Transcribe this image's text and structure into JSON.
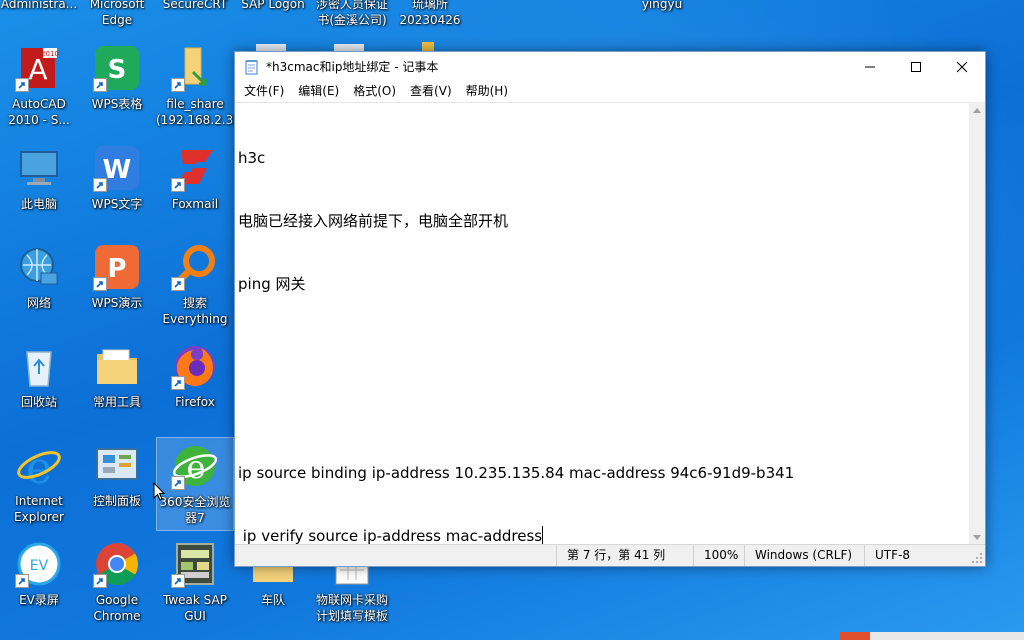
{
  "desktop": {
    "top_labels": [
      "Administra...",
      "Microsoft\nEdge",
      "SecureCRT",
      "SAP Logon",
      "涉密人员保证\n书(金溪公司)",
      "琉璃所\n20230426",
      "yingyu"
    ],
    "icons": [
      {
        "label": "AutoCAD\n2010 - S...",
        "icon": "autocad-icon"
      },
      {
        "label": "WPS表格",
        "icon": "wps-sheets-icon"
      },
      {
        "label": "file_share\n(192.168.2.3)",
        "icon": "folder-share-icon"
      },
      {
        "label": "此电脑",
        "icon": "this-pc-icon"
      },
      {
        "label": "WPS文字",
        "icon": "wps-writer-icon"
      },
      {
        "label": "Foxmail",
        "icon": "foxmail-icon"
      },
      {
        "label": "网络",
        "icon": "network-icon"
      },
      {
        "label": "WPS演示",
        "icon": "wps-presentation-icon"
      },
      {
        "label": "搜索\nEverything",
        "icon": "everything-search-icon"
      },
      {
        "label": "回收站",
        "icon": "recycle-bin-icon"
      },
      {
        "label": "常用工具",
        "icon": "folder-icon"
      },
      {
        "label": "Firefox",
        "icon": "firefox-icon"
      },
      {
        "label": "Internet\nExplorer",
        "icon": "ie-icon"
      },
      {
        "label": "控制面板",
        "icon": "control-panel-icon"
      },
      {
        "label": "360安全浏览\n器7",
        "icon": "360-browser-icon"
      },
      {
        "label": "EV录屏",
        "icon": "ev-recorder-icon"
      },
      {
        "label": "Google\nChrome",
        "icon": "chrome-icon"
      },
      {
        "label": "Tweak SAP\nGUI",
        "icon": "tweak-sap-icon"
      },
      {
        "label": "车队",
        "icon": "folder-icon"
      },
      {
        "label": "物联网卡采购\n计划填写模板",
        "icon": "spreadsheet-doc-icon"
      }
    ]
  },
  "notepad": {
    "title": "*h3cmac和ip地址绑定 - 记事本",
    "menu": [
      "文件(F)",
      "编辑(E)",
      "格式(O)",
      "查看(V)",
      "帮助(H)"
    ],
    "lines": [
      "h3c",
      "电脑已经接入网络前提下，电脑全部开机",
      "ping 网关",
      "",
      "",
      "ip source binding ip-address 10.235.135.84 mac-address 94c6-91d9-b341",
      " ip verify source ip-address mac-address"
    ],
    "status": {
      "position": "第 7 行，第 41 列",
      "zoom": "100%",
      "line_ending": "Windows (CRLF)",
      "encoding": "UTF-8"
    }
  },
  "colors": {
    "accent": "#0c6fd6",
    "window_border": "#7a9cc8"
  }
}
